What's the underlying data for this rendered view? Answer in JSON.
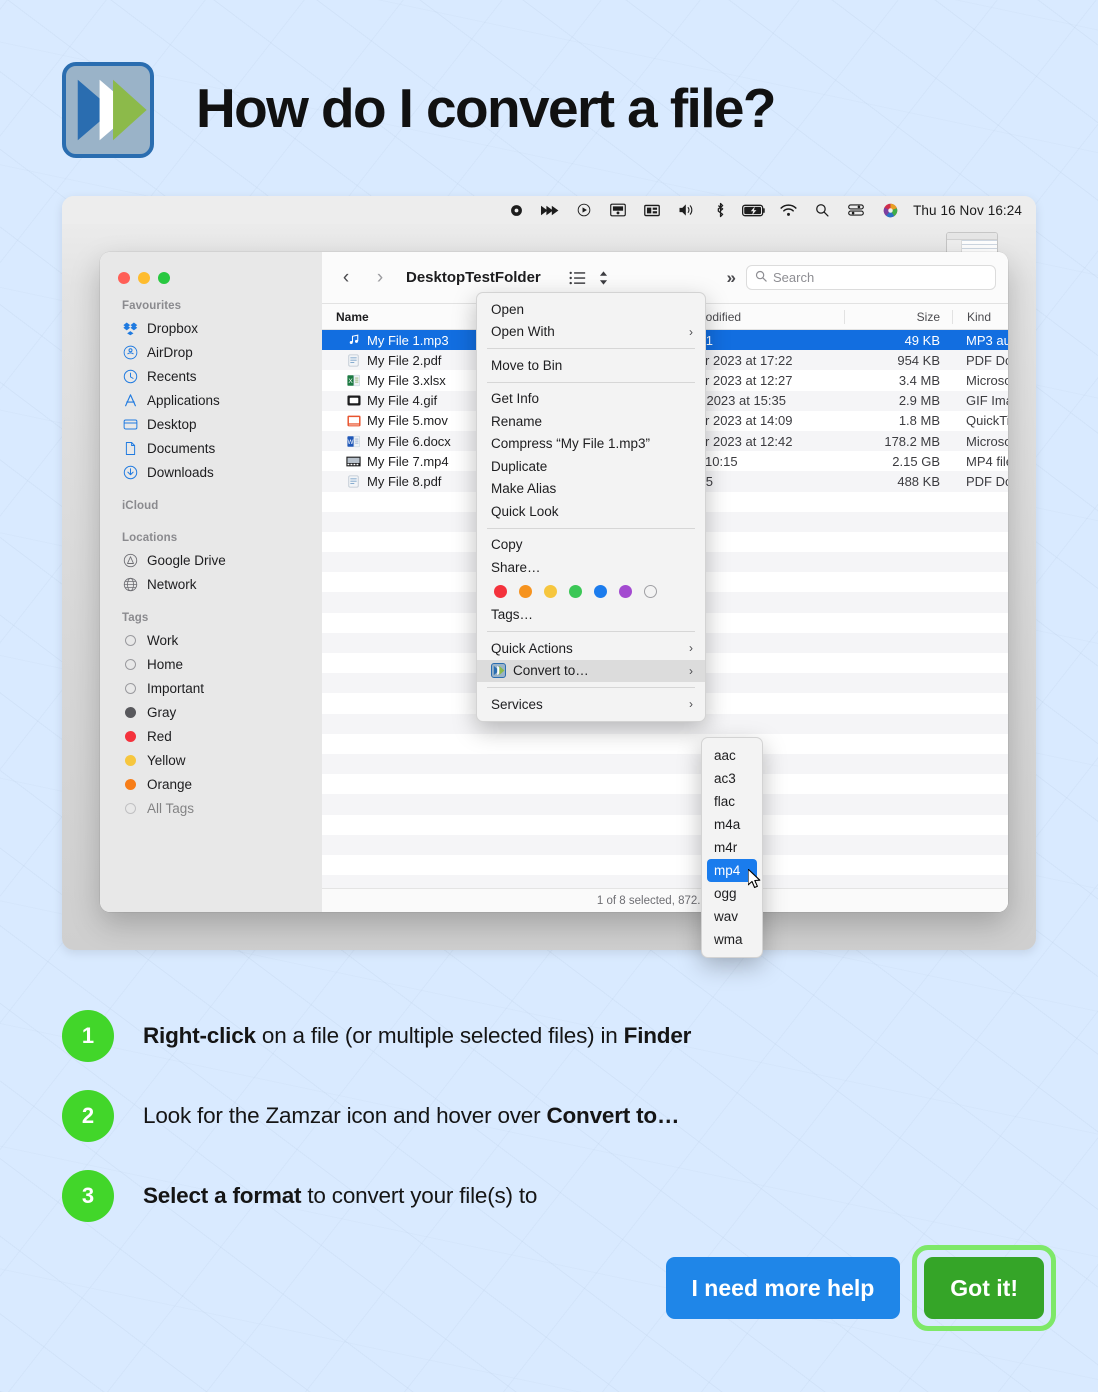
{
  "header": {
    "title": "How do I convert a file?",
    "logo_name": "zamzar-logo"
  },
  "menubar": {
    "icons": [
      "record-icon",
      "fast-forward-icon",
      "play-circle-icon",
      "screen-icon",
      "display-icon",
      "volume-icon",
      "bluetooth-icon",
      "battery-charging-icon",
      "wifi-icon",
      "search-icon",
      "control-center-icon",
      "color-wheel-icon"
    ],
    "clock": "Thu 16 Nov  16:24"
  },
  "finder": {
    "toolbar": {
      "back": "‹",
      "forward": "›",
      "folder_name": "DesktopTestFolder",
      "view_icon": "list-view-icon",
      "sort_icon": "sort-stepper-icon",
      "overflow": "»",
      "search_placeholder": "Search"
    },
    "columns": [
      "Name",
      "Date Modified",
      "Size",
      "Kind"
    ],
    "sort_caret": "⌃",
    "files": [
      {
        "name": "My File 1.mp3",
        "date": "at 14:51",
        "size": "49 KB",
        "kind": "MP3 au",
        "icon": "music-note-icon",
        "selected": true
      },
      {
        "name": "My File 2.pdf",
        "date": "vember 2023 at 17:22",
        "size": "954 KB",
        "kind": "PDF Do",
        "icon": "pdf-icon",
        "selected": false
      },
      {
        "name": "My File 3.xlsx",
        "date": "vember 2023 at 12:27",
        "size": "3.4 MB",
        "kind": "Microso",
        "icon": "excel-icon",
        "selected": false
      },
      {
        "name": "My File 4.gif",
        "date": "ember 2023 at 15:35",
        "size": "2.9 MB",
        "kind": "GIF Ima",
        "icon": "gif-icon",
        "selected": false
      },
      {
        "name": "My File 5.mov",
        "date": "vember 2023 at 14:09",
        "size": "1.8 MB",
        "kind": "QuickTi",
        "icon": "mov-icon",
        "selected": false
      },
      {
        "name": "My File 6.docx",
        "date": "vember 2023 at 12:42",
        "size": "178.2 MB",
        "kind": "Microso",
        "icon": "word-icon",
        "selected": false
      },
      {
        "name": "My File 7.mp4",
        "date": "day at 10:15",
        "size": "2.15 GB",
        "kind": "MP4 file",
        "icon": "mp4-icon",
        "selected": false
      },
      {
        "name": "My File 8.pdf",
        "date": "at 14:45",
        "size": "488 KB",
        "kind": "PDF Do",
        "icon": "pdf-icon",
        "selected": false
      }
    ],
    "status": "1 of 8 selected, 872.59 GB",
    "sidebar": {
      "groups": [
        {
          "label": "Favourites",
          "items": [
            {
              "label": "Dropbox",
              "icon": "dropbox-icon"
            },
            {
              "label": "AirDrop",
              "icon": "airdrop-icon"
            },
            {
              "label": "Recents",
              "icon": "clock-icon"
            },
            {
              "label": "Applications",
              "icon": "applications-icon"
            },
            {
              "label": "Desktop",
              "icon": "desktop-icon"
            },
            {
              "label": "Documents",
              "icon": "document-icon"
            },
            {
              "label": "Downloads",
              "icon": "download-icon"
            }
          ]
        },
        {
          "label": "iCloud",
          "items": []
        },
        {
          "label": "Locations",
          "items": [
            {
              "label": "Google Drive",
              "icon": "google-drive-icon"
            },
            {
              "label": "Network",
              "icon": "globe-icon"
            }
          ]
        },
        {
          "label": "Tags",
          "items": [
            {
              "label": "Work",
              "icon": "tag-dot",
              "color": "none"
            },
            {
              "label": "Home",
              "icon": "tag-dot",
              "color": "none"
            },
            {
              "label": "Important",
              "icon": "tag-dot",
              "color": "none"
            },
            {
              "label": "Gray",
              "icon": "tag-dot",
              "color": "#58585c"
            },
            {
              "label": "Red",
              "icon": "tag-dot",
              "color": "#f4323c"
            },
            {
              "label": "Yellow",
              "icon": "tag-dot",
              "color": "#f6cззe"
            },
            {
              "label": "Orange",
              "icon": "tag-dot",
              "color": "#f77d18"
            },
            {
              "label": "All Tags",
              "icon": "tag-dot",
              "color": "none"
            }
          ]
        }
      ]
    }
  },
  "context_menu": {
    "items": [
      {
        "label": "Open",
        "arrow": ""
      },
      {
        "label": "Open With",
        "arrow": "›"
      },
      {
        "sep": true
      },
      {
        "label": "Move to Bin",
        "arrow": ""
      },
      {
        "sep": true
      },
      {
        "label": "Get Info",
        "arrow": ""
      },
      {
        "label": "Rename",
        "arrow": ""
      },
      {
        "label": "Compress “My File 1.mp3”",
        "arrow": ""
      },
      {
        "label": "Duplicate",
        "arrow": ""
      },
      {
        "label": "Make Alias",
        "arrow": ""
      },
      {
        "label": "Quick Look",
        "arrow": ""
      },
      {
        "sep": true
      },
      {
        "label": "Copy",
        "arrow": ""
      },
      {
        "label": "Share…",
        "arrow": ""
      },
      {
        "colors": true
      },
      {
        "label": "Tags…",
        "arrow": ""
      },
      {
        "sep": true
      },
      {
        "label": "Quick Actions",
        "arrow": "›"
      },
      {
        "label": "Convert to…",
        "arrow": "›",
        "highlighted": true,
        "icon": "zamzar-icon"
      },
      {
        "sep": true
      },
      {
        "label": "Services",
        "arrow": "›"
      }
    ],
    "tag_colors": [
      "#f4323c",
      "#f6931f",
      "#f6c63e",
      "#3bc756",
      "#1c7ced",
      "#a34ad0",
      "none"
    ]
  },
  "submenu": {
    "items": [
      "aac",
      "ac3",
      "flac",
      "m4a",
      "m4r",
      "mp4",
      "ogg",
      "wav",
      "wma"
    ],
    "selected": "mp4"
  },
  "steps": [
    {
      "number": "1",
      "parts": [
        {
          "t": "Right-click",
          "b": true
        },
        {
          "t": " on a file (or multiple selected files) in ",
          "b": false
        },
        {
          "t": "Finder",
          "b": true
        }
      ]
    },
    {
      "number": "2",
      "parts": [
        {
          "t": "Look for the Zamzar icon and hover over ",
          "b": false
        },
        {
          "t": "Convert to…",
          "b": true
        }
      ]
    },
    {
      "number": "3",
      "parts": [
        {
          "t": "Select a format",
          "b": true
        },
        {
          "t": " to convert your file(s) to",
          "b": false
        }
      ]
    }
  ],
  "buttons": {
    "more_help": "I need more help",
    "got_it": "Got it!"
  },
  "colors": {
    "page_bg": "#d9eaff",
    "accent_blue": "#1f86e8",
    "accent_green": "#35a528",
    "focus_green": "#7ee868",
    "step_circle": "#42d62a",
    "selection_blue": "#126ee0"
  }
}
